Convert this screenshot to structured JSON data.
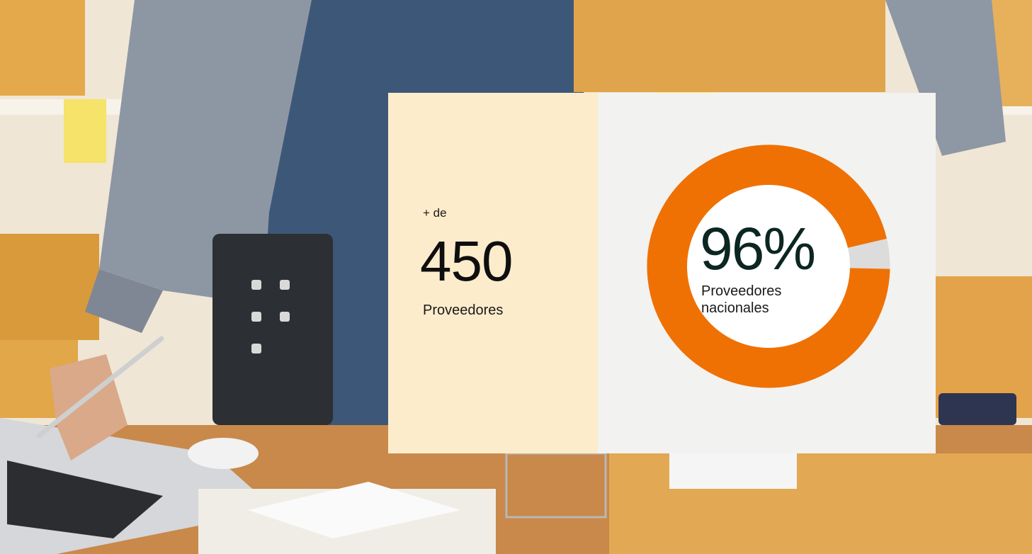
{
  "providers": {
    "prefix": "+ de",
    "count": "450",
    "label": "Proveedores"
  },
  "national": {
    "percent_text": "96%",
    "percent_value": 96,
    "label": "Proveedores nacionales"
  },
  "colors": {
    "left_panel": "#fdeccb",
    "right_panel": "#f2f2f0",
    "donut_fill": "#ef7104",
    "donut_rest": "#dcdcdc"
  }
}
